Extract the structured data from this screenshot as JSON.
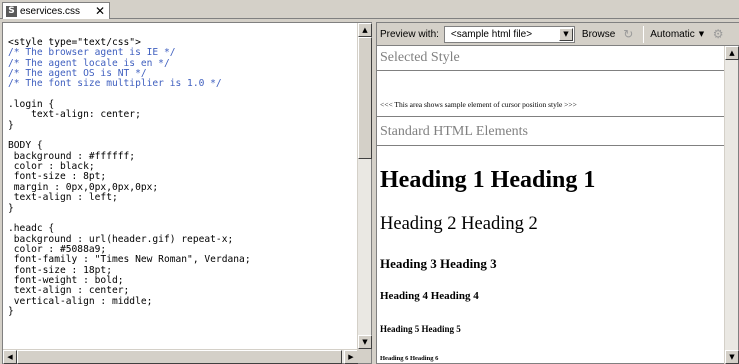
{
  "tab": {
    "icon": "css-file-icon",
    "icon_glyph": "S",
    "label": "eservices.css",
    "close_glyph": "✕"
  },
  "editor": {
    "lines": [
      {
        "cls": "c-tag",
        "text": "<style type=\"text/css\">"
      },
      {
        "cls": "c-cmt",
        "text": "/* The browser agent is IE */"
      },
      {
        "cls": "c-cmt",
        "text": "/* The agent locale is en */"
      },
      {
        "cls": "c-cmt",
        "text": "/* The agent OS is NT */"
      },
      {
        "cls": "c-cmt",
        "text": "/* The font size multiplier is 1.0 */"
      },
      {
        "cls": "c-prop",
        "text": ""
      },
      {
        "cls": "c-sel",
        "text": ".login {"
      },
      {
        "cls": "c-prop",
        "text": "    text-align: center;"
      },
      {
        "cls": "c-sel",
        "text": "}"
      },
      {
        "cls": "c-prop",
        "text": ""
      },
      {
        "cls": "c-sel",
        "text": "BODY {"
      },
      {
        "cls": "c-prop",
        "text": " background : #ffffff;"
      },
      {
        "cls": "c-prop",
        "text": " color : black;"
      },
      {
        "cls": "c-prop",
        "text": " font-size : 8pt;"
      },
      {
        "cls": "c-prop",
        "text": " margin : 0px,0px,0px,0px;"
      },
      {
        "cls": "c-prop",
        "text": " text-align : left;"
      },
      {
        "cls": "c-sel",
        "text": "}"
      },
      {
        "cls": "c-prop",
        "text": ""
      },
      {
        "cls": "c-sel",
        "text": ".headc {"
      },
      {
        "cls": "c-prop",
        "text": " background : url(header.gif) repeat-x;"
      },
      {
        "cls": "c-prop",
        "text": " color : #5088a9;"
      },
      {
        "cls": "c-prop",
        "text": " font-family : \"Times New Roman\", Verdana;"
      },
      {
        "cls": "c-prop",
        "text": " font-size : 18pt;"
      },
      {
        "cls": "c-prop",
        "text": " font-weight : bold;"
      },
      {
        "cls": "c-prop",
        "text": " text-align : center;"
      },
      {
        "cls": "c-prop",
        "text": " vertical-align : middle;"
      },
      {
        "cls": "c-sel",
        "text": "}"
      }
    ],
    "scroll_up_glyph": "▲",
    "scroll_down_glyph": "▼",
    "scroll_left_glyph": "◀",
    "scroll_right_glyph": "▶"
  },
  "preview": {
    "toolbar": {
      "preview_with_label": "Preview with:",
      "file_select_value": "<sample html file>",
      "dropdown_glyph": "▼",
      "browse_label": "Browse",
      "refresh_icon": "refresh-icon",
      "refresh_glyph": "↻",
      "automatic_label": "Automatic",
      "automatic_dd_glyph": "▼",
      "globe_icon": "globe-icon",
      "globe_glyph": "⚙"
    },
    "selected_style_title": "Selected Style",
    "sample_note": "<<< This area shows sample element of cursor position style >>>",
    "standard_elements_title": "Standard HTML Elements",
    "headings": [
      "Heading 1 Heading 1",
      "Heading 2 Heading 2",
      "Heading 3 Heading 3",
      "Heading 4 Heading 4",
      "Heading 5 Heading 5",
      "Heading 6 Heading 6"
    ],
    "scroll_up_glyph": "▲",
    "scroll_down_glyph": "▼"
  }
}
